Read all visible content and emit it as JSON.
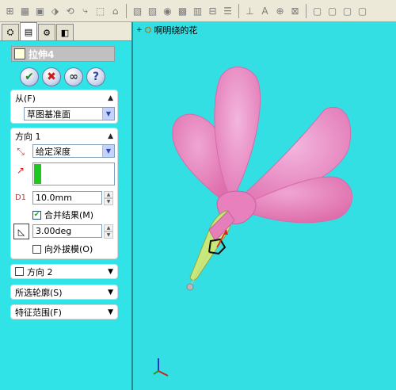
{
  "toolbar": {
    "icons": [
      "sketch-icon",
      "smart-dimension-icon",
      "line-icon",
      "rectangle-icon",
      "circle-icon",
      "arc-icon",
      "spline-icon",
      "point-icon",
      "centerline-icon",
      "text-icon",
      "mirror-icon",
      "trim-icon",
      "offset-icon",
      "grid-icon",
      "construction-icon",
      "relations-icon",
      "centerpoint-icon",
      "note-icon",
      "view-icon",
      "view-front-icon",
      "view-top-icon"
    ]
  },
  "tabs": [
    {
      "name": "feature-manager-tab",
      "glyph": "⛭"
    },
    {
      "name": "property-manager-tab",
      "glyph": "▤"
    },
    {
      "name": "configuration-manager-tab",
      "glyph": "⚙"
    },
    {
      "name": "display-manager-tab",
      "glyph": "◧"
    }
  ],
  "pm": {
    "title": "拉伸4",
    "ok": "✔",
    "cancel": "✖",
    "preview": "∞",
    "help": "?"
  },
  "from_group": {
    "header": "从(F)",
    "value": "草图基准面"
  },
  "direction1": {
    "header": "方向 1",
    "end_condition": "给定深度",
    "depth": "10.0mm",
    "merge_label": "合并结果(M)",
    "merge_checked": true,
    "draft_angle": "3.00deg",
    "draft_outward_label": "向外拔模(O)",
    "draft_outward_checked": false
  },
  "direction2": {
    "header": "方向 2"
  },
  "selected_contours": {
    "header": "所选轮廓(S)"
  },
  "feature_scope": {
    "header": "特征范围(F)"
  },
  "graphics": {
    "tree_root": "啊明绕的花"
  },
  "colors": {
    "background": "#34dfe3",
    "petal": "#e98ac2",
    "stem": "#c8e87a"
  }
}
